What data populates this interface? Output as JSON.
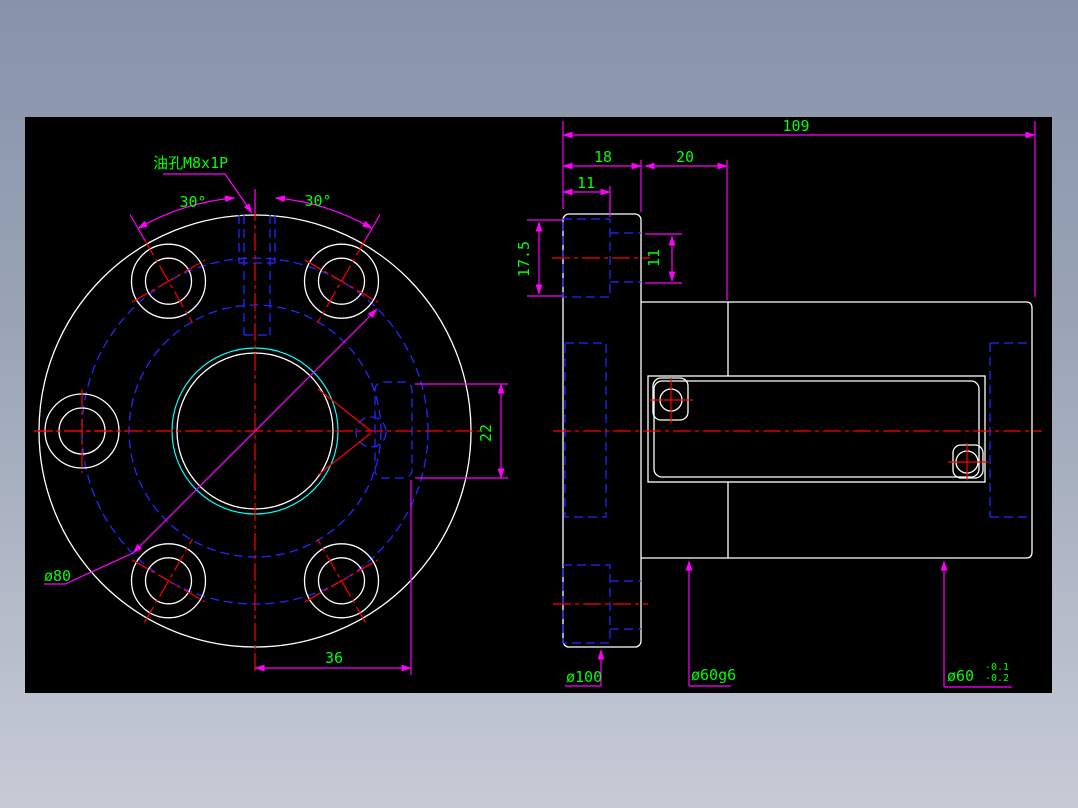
{
  "page": {
    "background_top": "#8793aa",
    "background_bottom": "#c6cbd6",
    "canvas_background": "#000000"
  },
  "drawing_colors": {
    "outline": "#ffffff",
    "hidden_line": "#2626ff",
    "centerline": "#ff0000",
    "dimension_line": "#ff00ff",
    "dimension_text": "#00ff00",
    "thread_line": "#00ffff"
  },
  "front_view": {
    "oil_hole_label": "油孔M8x1P",
    "angle_left": "30°",
    "angle_right": "30°",
    "bolt_circle_diameter": "ø80",
    "keyway_height": "22",
    "keyway_offset": "36"
  },
  "side_view": {
    "overall_length": "109",
    "flange_thickness": "18",
    "neck_length": "20",
    "counterbore_depth": "11",
    "counterbore_height": "17.5",
    "bolt_hole_diameter": "11",
    "flange_diameter": "ø100",
    "body_diameter": "ø60g6",
    "end_diameter": "ø60",
    "end_tolerance_upper": "-0.1",
    "end_tolerance_lower": "-0.2"
  }
}
